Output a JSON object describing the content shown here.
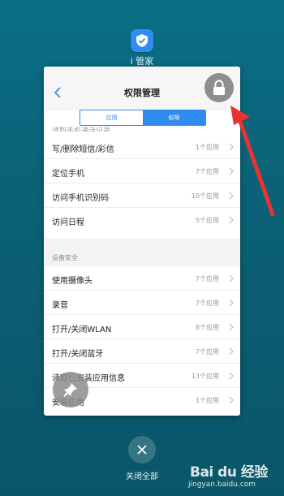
{
  "app": {
    "name": "i 管家",
    "icon": "shield-check-icon"
  },
  "header": {
    "title": "权限管理",
    "back_icon": "chevron-left-icon",
    "lock_icon": "lock-icon"
  },
  "tabs": [
    {
      "label": "应用",
      "active": false
    },
    {
      "label": "权限",
      "active": true
    }
  ],
  "list_top": {
    "partial_text": "读取手机通话记录",
    "rows": [
      {
        "name": "写/删除短信/彩信",
        "count": "1个应用"
      },
      {
        "name": "定位手机",
        "count": "7个应用"
      },
      {
        "name": "访问手机识别码",
        "count": "10个应用"
      },
      {
        "name": "访问日程",
        "count": "5个应用"
      }
    ]
  },
  "section": {
    "title": "设备安全",
    "rows": [
      {
        "name": "使用摄像头",
        "count": "7个应用"
      },
      {
        "name": "录音",
        "count": "7个应用"
      },
      {
        "name": "打开/关闭WLAN",
        "count": "8个应用"
      },
      {
        "name": "打开/关闭蓝牙",
        "count": "7个应用"
      },
      {
        "name": "读取已安装应用信息",
        "count": "13个应用"
      },
      {
        "name": "安装应用",
        "count": "1个应用"
      }
    ]
  },
  "bottom": {
    "close_all_label": "关闭全部"
  },
  "watermark": {
    "logo": "Bai du 经验",
    "url": "jingyan.baidu.com"
  },
  "colors": {
    "accent": "#2f8cf0",
    "background": "#0b6176",
    "arrow": "#e8332f"
  }
}
